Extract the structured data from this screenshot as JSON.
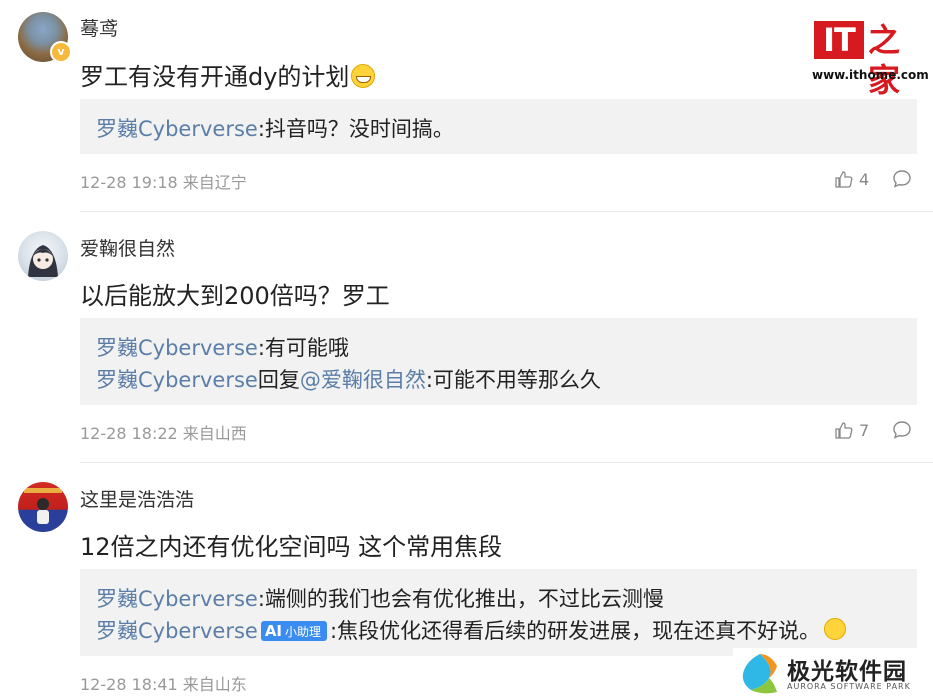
{
  "watermarks": {
    "ithome_logo_text": "IT",
    "ithome_logo_zh": "之家",
    "ithome_url": "www.ithome.com",
    "aurora_name": "极光软件园",
    "aurora_en": "AURORA SOFTWARE PARK"
  },
  "comments": [
    {
      "username": "蓦鸢",
      "content": "罗工有没有开通dy的计划",
      "verified_badge": "v",
      "replies": [
        {
          "author": "罗巍Cyberverse",
          "sep": ":",
          "text": "抖音吗？没时间搞。"
        }
      ],
      "time": "12-28 19:18 来自辽宁",
      "likes": "4"
    },
    {
      "username": "爱鞠很自然",
      "content": "以后能放大到200倍吗？罗工",
      "replies": [
        {
          "author": "罗巍Cyberverse",
          "sep": ":",
          "text": "有可能哦"
        },
        {
          "author": "罗巍Cyberverse",
          "mid": "回复",
          "mention": "@爱鞠很自然",
          "sep": ":",
          "text": "可能不用等那么久"
        }
      ],
      "time": "12-28 18:22 来自山西",
      "likes": "7"
    },
    {
      "username": "这里是浩浩浩",
      "content": "12倍之内还有优化空间吗 这个常用焦段",
      "replies": [
        {
          "author": "罗巍Cyberverse",
          "sep": ":",
          "text": "端侧的我们也会有优化推出，不过比云测慢"
        },
        {
          "author": "罗巍Cyberverse",
          "badge_ai": "AI",
          "badge_label": "小助理",
          "sep": ":",
          "text": "焦段优化还得看后续的研发进展，现在还真不好说。"
        }
      ],
      "time": "12-28 18:41 来自山东"
    }
  ],
  "icons": {
    "like": "thumbs-up-icon",
    "reply": "comment-bubble-icon"
  },
  "colors": {
    "link": "#5b7ea8",
    "reply_bg": "#f2f2f2",
    "meta": "#999999",
    "ithome_red": "#d71920"
  }
}
